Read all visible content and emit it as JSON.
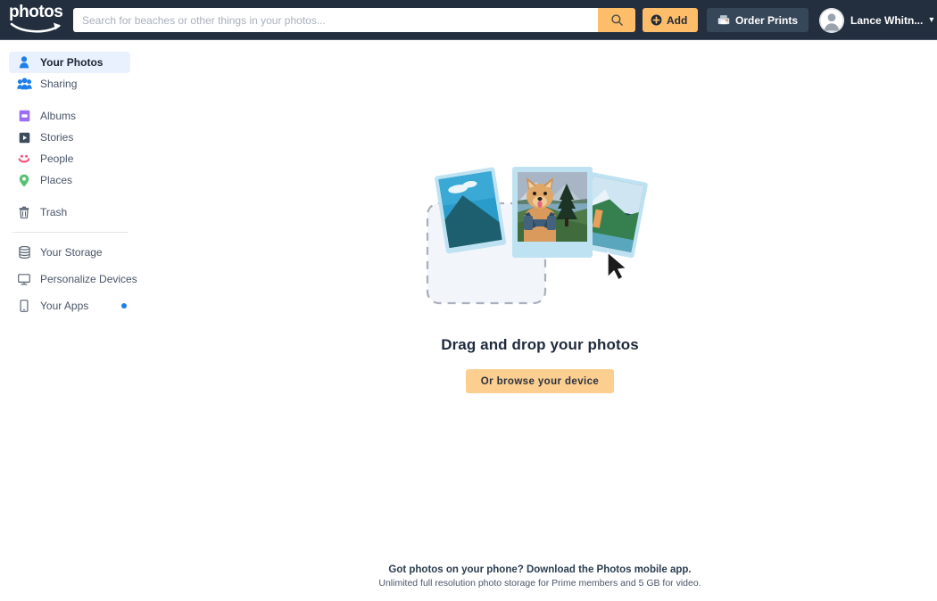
{
  "header": {
    "logo_text": "photos",
    "logo_icon": "amazon-smile-logo",
    "search": {
      "placeholder": "Search for beaches or other things in your photos...",
      "value": "",
      "button_icon": "search-icon"
    },
    "add_button": {
      "label": "Add",
      "icon": "plus-circle-icon"
    },
    "order_prints_button": {
      "label": "Order Prints",
      "icon": "printer-icon"
    },
    "account": {
      "name": "Lance Whitn...",
      "avatar_icon": "user-avatar-icon",
      "chevron_icon": "chevron-down-icon"
    },
    "colors": {
      "background": "#232f3e",
      "accent": "#febd69",
      "button": "#37475a"
    }
  },
  "sidebar": {
    "items": [
      {
        "label": "Your Photos",
        "icon": "person-icon",
        "active": true,
        "badge": false
      },
      {
        "label": "Sharing",
        "icon": "people-group-icon",
        "active": false,
        "badge": false
      },
      {
        "label": "Albums",
        "icon": "album-icon",
        "active": false,
        "badge": false
      },
      {
        "label": "Stories",
        "icon": "play-square-icon",
        "active": false,
        "badge": false
      },
      {
        "label": "People",
        "icon": "smiley-face-icon",
        "active": false,
        "badge": false
      },
      {
        "label": "Places",
        "icon": "map-pin-icon",
        "active": false,
        "badge": false
      },
      {
        "label": "Trash",
        "icon": "trash-icon",
        "active": false,
        "badge": false
      },
      {
        "label": "Your Storage",
        "icon": "storage-database-icon",
        "active": false,
        "badge": false
      },
      {
        "label": "Personalize Devices",
        "icon": "monitor-icon",
        "active": false,
        "badge": true
      },
      {
        "label": "Your Apps",
        "icon": "mobile-phone-icon",
        "active": false,
        "badge": true
      }
    ],
    "badge_color": "#1e7fe8",
    "active_color": "#e8f1fd"
  },
  "main": {
    "illustration_name": "photos-drag-drop-illustration",
    "title": "Drag and drop your photos",
    "browse_button": "Or browse your device"
  },
  "footer": {
    "title": "Got photos on your phone? Download the Photos mobile app.",
    "subtitle": "Unlimited full resolution photo storage for Prime members and 5 GB for video."
  }
}
